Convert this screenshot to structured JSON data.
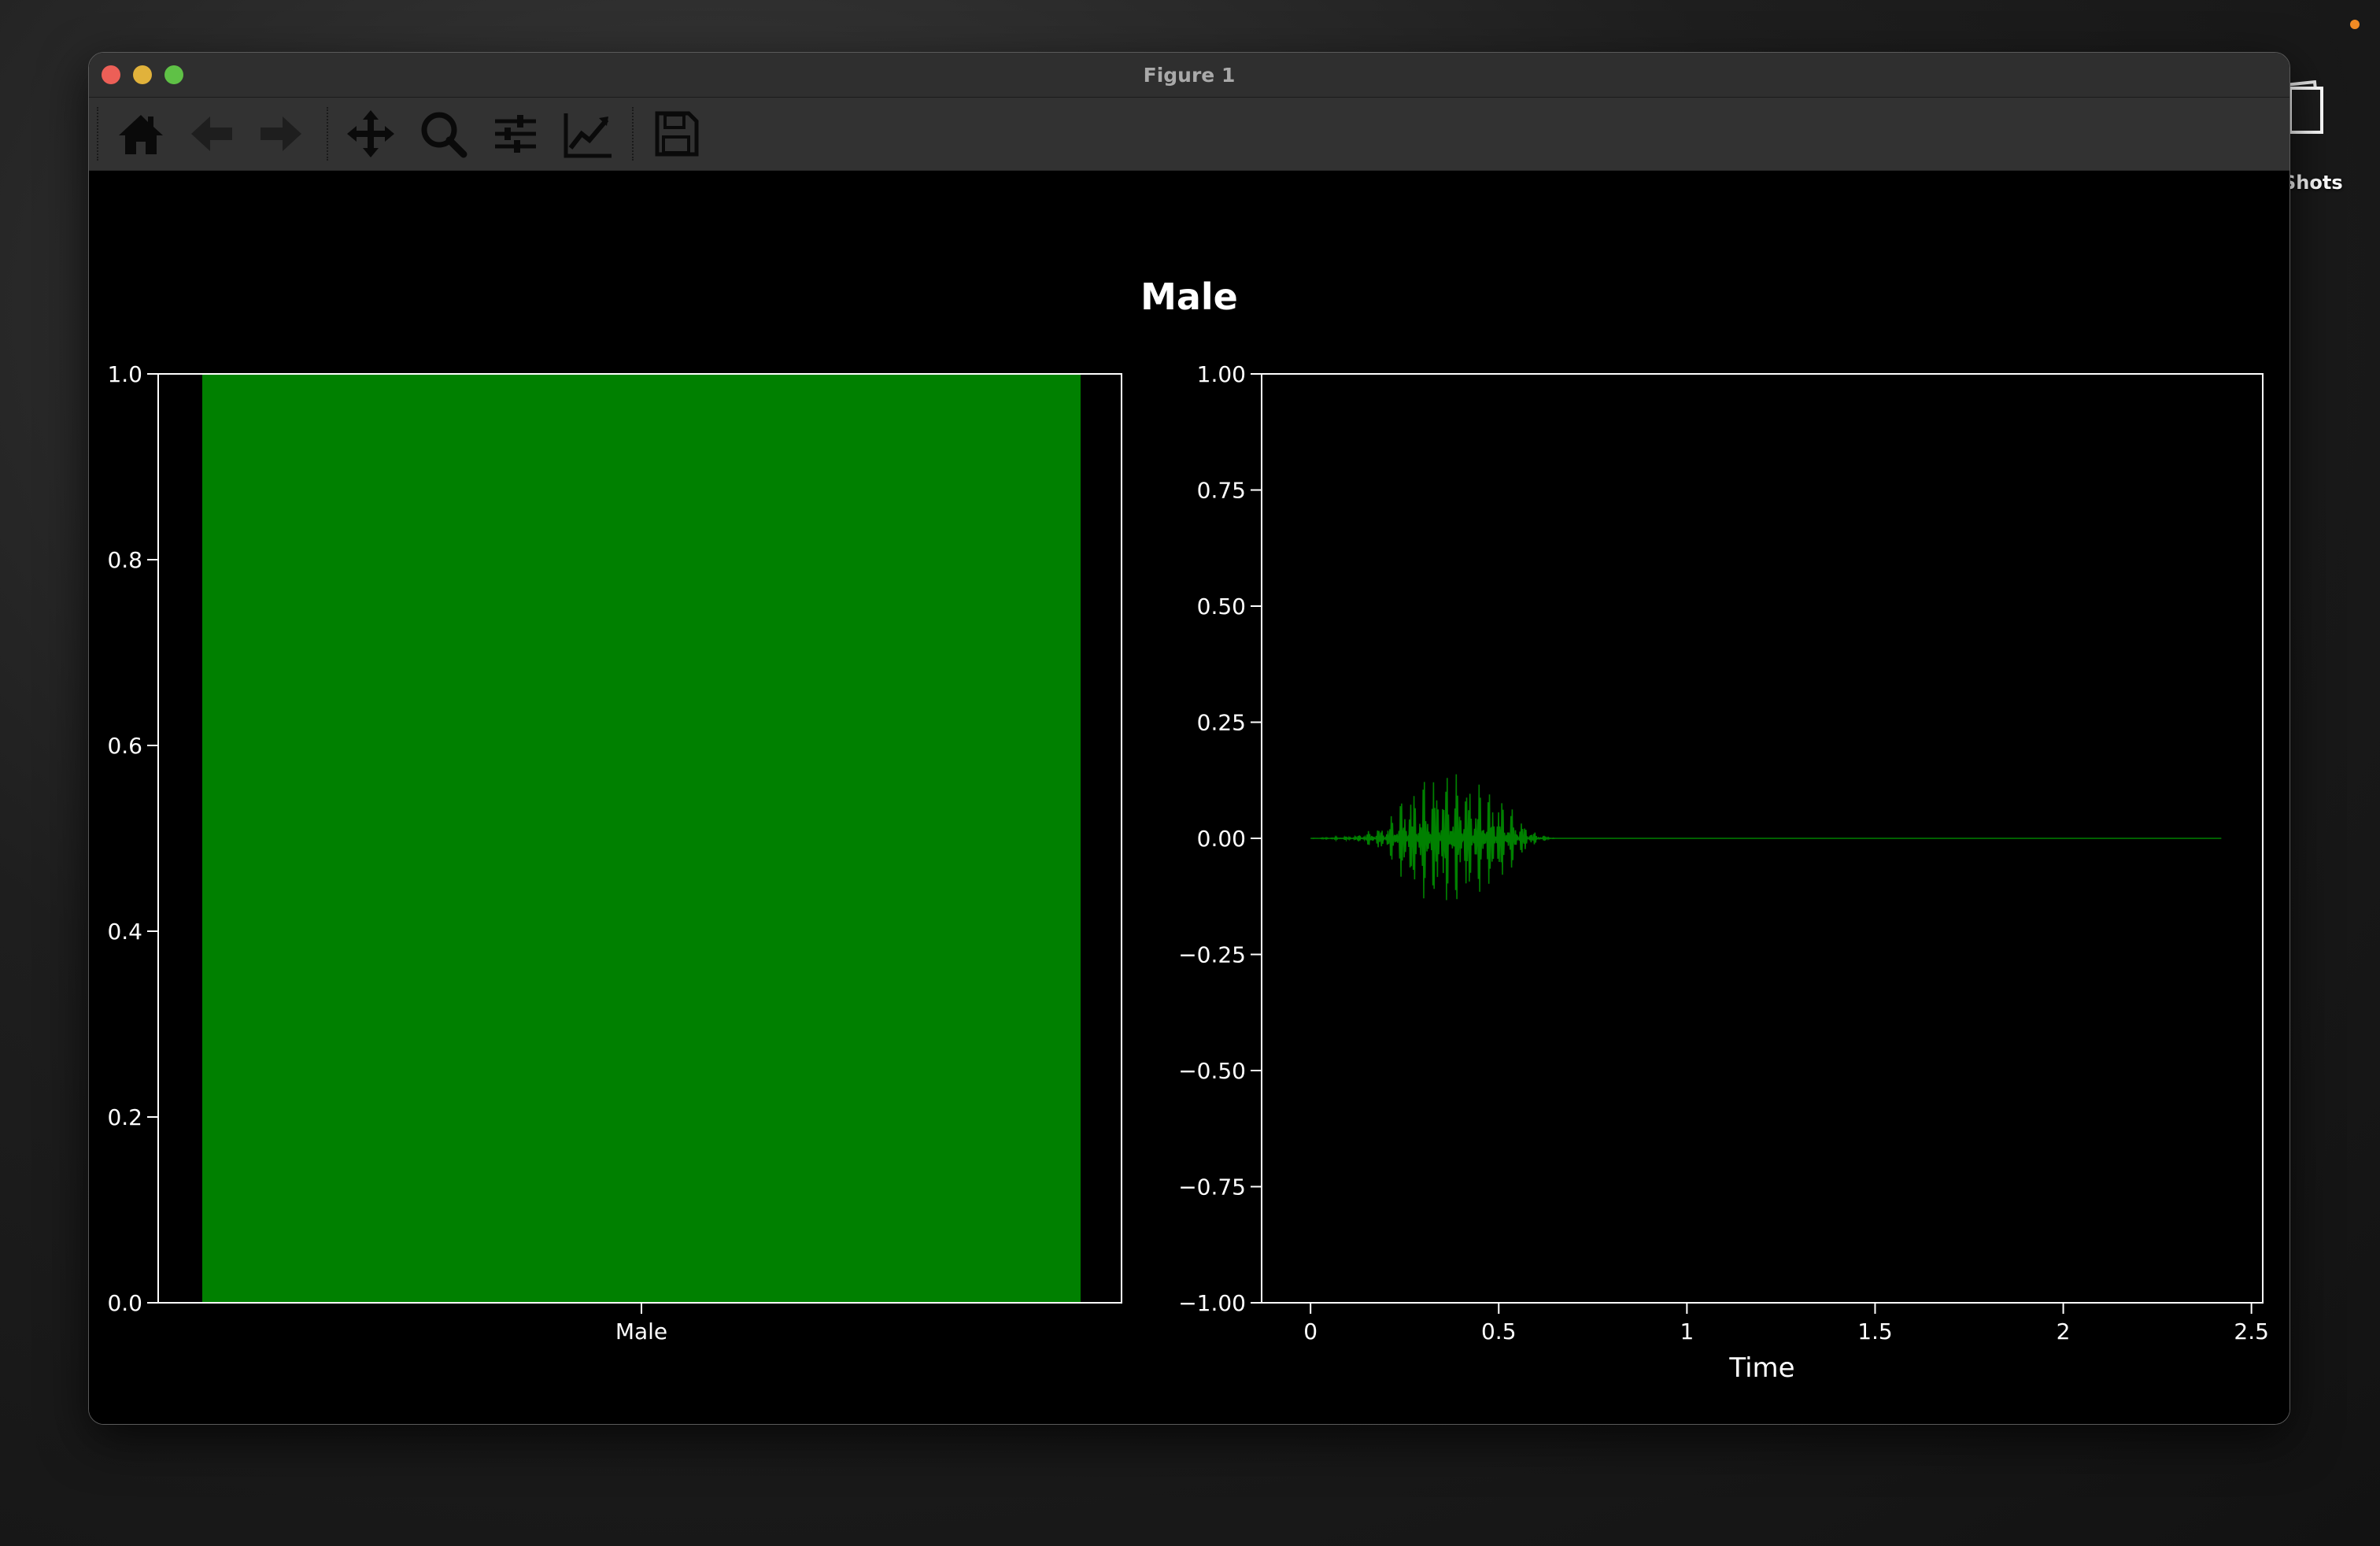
{
  "window": {
    "title": "Figure 1"
  },
  "desktop": {
    "icon_label": "Shots"
  },
  "toolbar": {
    "buttons": [
      {
        "name": "home-button",
        "icon": "home-icon"
      },
      {
        "name": "back-button",
        "icon": "arrow-left-icon"
      },
      {
        "name": "forward-button",
        "icon": "arrow-right-icon"
      },
      {
        "name": "pan-button",
        "icon": "move-icon"
      },
      {
        "name": "zoom-button",
        "icon": "magnifier-icon"
      },
      {
        "name": "configure-subplots-button",
        "icon": "sliders-icon"
      },
      {
        "name": "edit-axis-button",
        "icon": "line-chart-icon"
      },
      {
        "name": "save-button",
        "icon": "floppy-disk-icon"
      }
    ]
  },
  "colors": {
    "bar": "#008000",
    "waveform": "#008000",
    "axes": "#ffffff",
    "background": "#000000"
  },
  "chart_data": [
    {
      "type": "bar",
      "title": "Male",
      "categories": [
        "Male"
      ],
      "values": [
        1.0
      ],
      "xlabel": "",
      "ylabel": "",
      "ylim": [
        0,
        1.0
      ],
      "yticks": [
        "0.0",
        "0.2",
        "0.4",
        "0.6",
        "0.8",
        "1.0"
      ]
    },
    {
      "type": "line",
      "title": "",
      "xlabel": "Time",
      "ylabel": "",
      "xlim": [
        -0.13,
        2.53
      ],
      "ylim": [
        -1.0,
        1.0
      ],
      "xticks": [
        "0",
        "0.5",
        "1",
        "1.5",
        "2",
        "2.5"
      ],
      "yticks": [
        "1.00",
        "0.75",
        "0.50",
        "0.25",
        "0.00",
        "−0.25",
        "−0.50",
        "−0.75",
        "−1.00"
      ],
      "series": [
        {
          "x": [
            0,
            0.12,
            0.2,
            0.25,
            0.3,
            0.35,
            0.4,
            0.45,
            0.5,
            0.55,
            0.6,
            0.65,
            2.42
          ],
          "y_envelope": [
            0,
            0.005,
            0.03,
            0.1,
            0.13,
            0.15,
            0.14,
            0.12,
            0.1,
            0.05,
            0.01,
            0,
            0
          ]
        }
      ]
    }
  ]
}
